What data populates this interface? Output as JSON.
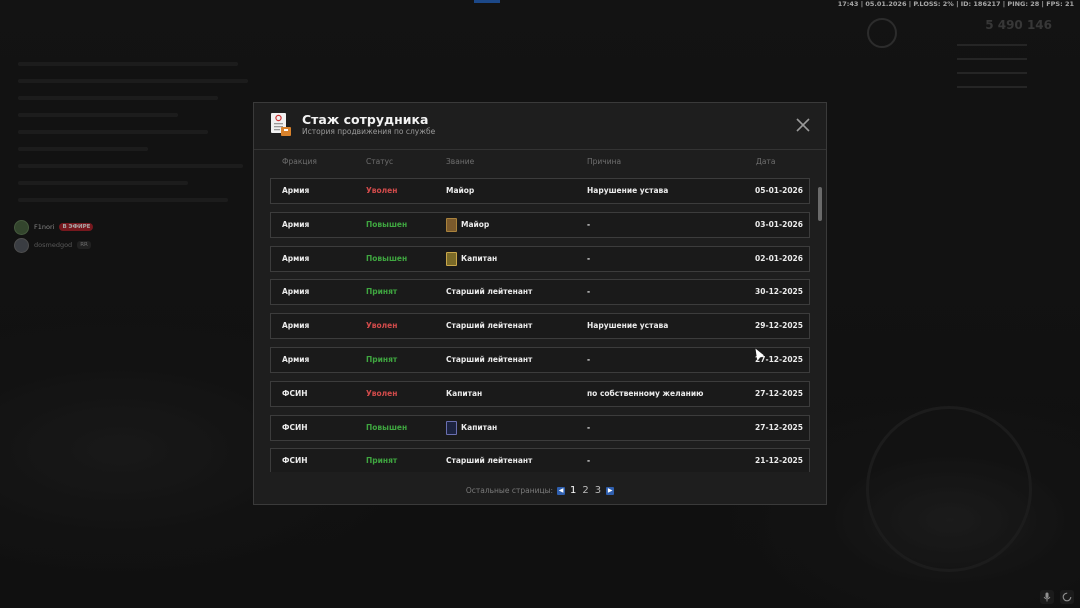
{
  "hud": {
    "status_line": "17:43 | 05.01.2026 | P.LOSS: 2% | ID: 186217 | PING: 28 | FPS: 21",
    "money": "5 490 146"
  },
  "voice": {
    "users": [
      {
        "name": "F1nori",
        "badge": "В ЭФИРЕ"
      },
      {
        "name": "dosmedgod",
        "badge": "RR"
      }
    ]
  },
  "modal": {
    "title": "Стаж сотрудника",
    "subtitle": "История продвижения по службе",
    "columns": {
      "fraction": "Фракция",
      "status": "Статус",
      "rank": "Звание",
      "reason": "Причина",
      "date": "Дата"
    },
    "rows": [
      {
        "fraction": "Армия",
        "status": "Уволен",
        "status_color": "red",
        "rank": "Майор",
        "rank_icon": "",
        "reason": "Нарушение устава",
        "date": "05-01-2026"
      },
      {
        "fraction": "Армия",
        "status": "Повышен",
        "status_color": "green",
        "rank": "Майор",
        "rank_icon": "brown",
        "reason": "-",
        "date": "03-01-2026"
      },
      {
        "fraction": "Армия",
        "status": "Повышен",
        "status_color": "green",
        "rank": "Капитан",
        "rank_icon": "gold",
        "reason": "-",
        "date": "02-01-2026"
      },
      {
        "fraction": "Армия",
        "status": "Принят",
        "status_color": "green",
        "rank": "Старший лейтенант",
        "rank_icon": "",
        "reason": "-",
        "date": "30-12-2025"
      },
      {
        "fraction": "Армия",
        "status": "Уволен",
        "status_color": "red",
        "rank": "Старший лейтенант",
        "rank_icon": "",
        "reason": "Нарушение устава",
        "date": "29-12-2025"
      },
      {
        "fraction": "Армия",
        "status": "Принят",
        "status_color": "green",
        "rank": "Старший лейтенант",
        "rank_icon": "",
        "reason": "-",
        "date": "27-12-2025"
      },
      {
        "fraction": "ФСИН",
        "status": "Уволен",
        "status_color": "red",
        "rank": "Капитан",
        "rank_icon": "",
        "reason": "по собственному желанию",
        "date": "27-12-2025"
      },
      {
        "fraction": "ФСИН",
        "status": "Повышен",
        "status_color": "green",
        "rank": "Капитан",
        "rank_icon": "navy",
        "reason": "-",
        "date": "27-12-2025"
      },
      {
        "fraction": "ФСИН",
        "status": "Принят",
        "status_color": "green",
        "rank": "Старший лейтенант",
        "rank_icon": "",
        "reason": "-",
        "date": "21-12-2025"
      }
    ],
    "pagination": {
      "label": "Остальные страницы:",
      "pages": [
        "1",
        "2",
        "3"
      ],
      "current": "1"
    }
  },
  "colors": {
    "status_red": "#d24b4b",
    "status_green": "#3fa640",
    "page_arrow": "#2f5fae"
  }
}
